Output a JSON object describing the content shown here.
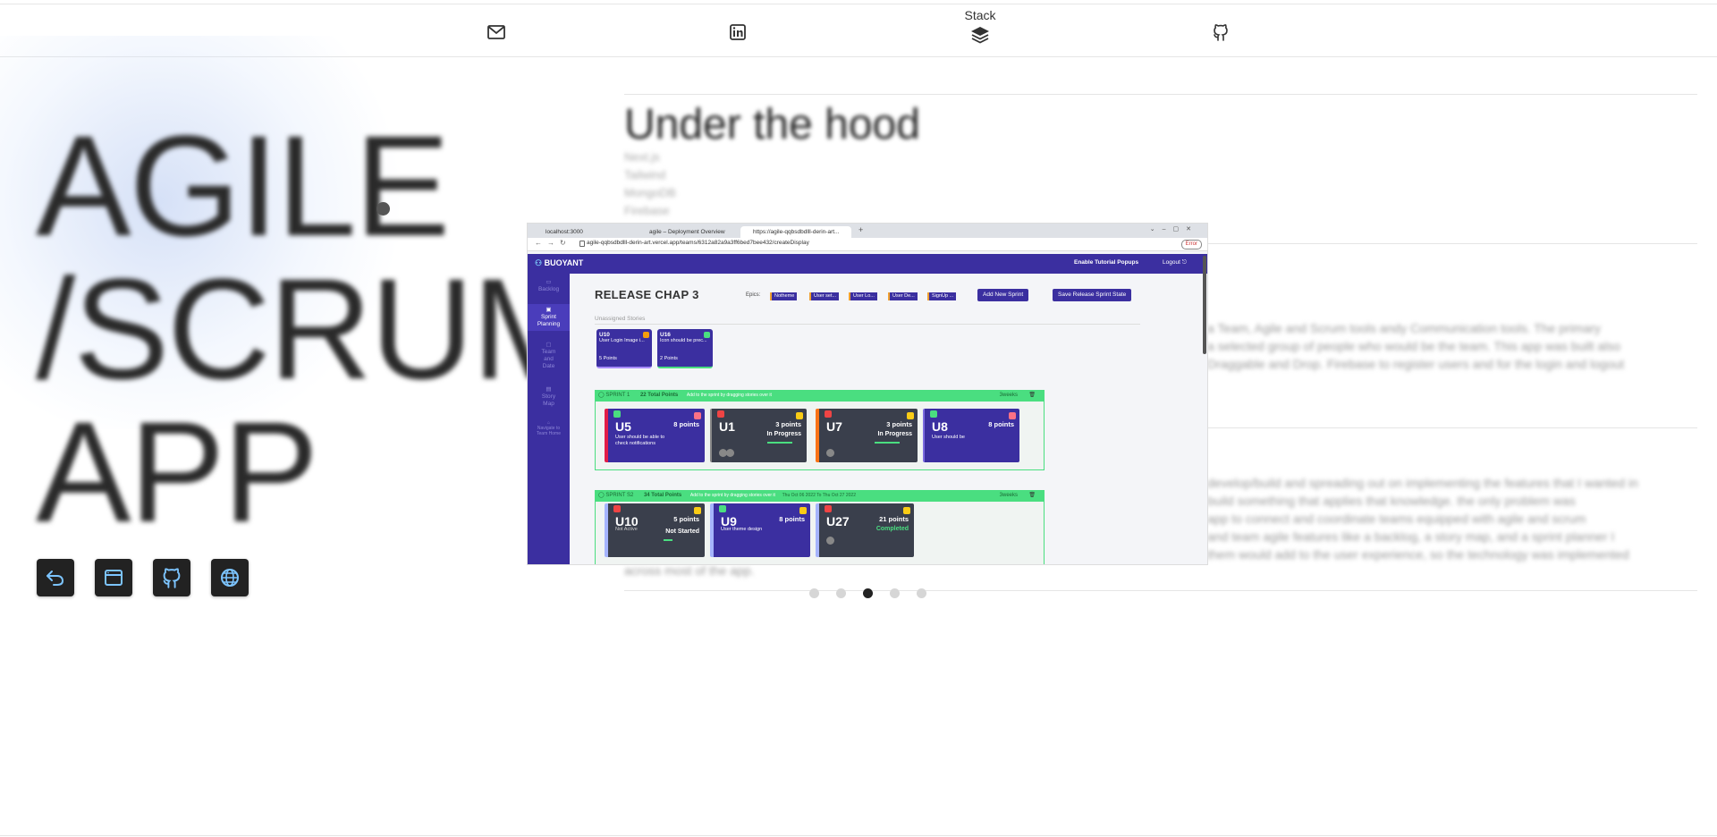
{
  "nav": {
    "stack_label": "Stack",
    "items": [
      "mail-icon",
      "linkedin-icon",
      "layers-icon",
      "github-icon"
    ]
  },
  "hero": {
    "title": "AGILE\n/SCRUM\nAPP",
    "buttons": [
      "back-icon",
      "window-icon",
      "github-icon",
      "globe-icon"
    ]
  },
  "right": {
    "heading": "Under the hood",
    "stack_list": [
      "Next.js",
      "Tailwind",
      "MongoDB",
      "Firebase"
    ],
    "para1": [
      "a Team, Agile and Scrum tools andy Communication tools. The primary",
      "a selected group of people who would be the team. This app was built also",
      "Draggable and Drop. Firebase to register users and for the login and logout"
    ],
    "para2": [
      "develop/build and spreading out on implementing the features that I wanted in",
      "build something that applies that knowledge. the only problem was",
      "app to connect and coordinate teams equipped with agile and scrum",
      "and team agile features like a backlog, a story map, and a sprint planner I",
      "them would add to the user experience, so the technology was implemented",
      "across most of the app."
    ]
  },
  "screenshot": {
    "tabs": [
      "localhost:3000",
      "agile – Deployment Overview",
      "https://agile-qqbsdbdlll-derin-art..."
    ],
    "url": "agile-qqbsdbdlll-derin-art.vercel.app/teams/6312a82a9a3ff6bed7bee432/createDisplay",
    "error_label": "Error",
    "brand": "BUOYANT",
    "tutorial": "Enable Tutorial Popups",
    "logout": "Logout",
    "sidebar": [
      "Backlog",
      "Sprint Planning",
      "Team and Date",
      "Story Map",
      "Navigate to Team Home"
    ],
    "release_title": "RELEASE CHAP 3",
    "epics_label": "Epics:",
    "epics": [
      "Notheme",
      "User set...",
      "User Lo...",
      "User De...",
      "SignUp ..."
    ],
    "add_sprint": "Add New Sprint",
    "save_state": "Save Release Sprint State",
    "unassigned_label": "Unassigned Stories",
    "unassigned": [
      {
        "id": "U10",
        "text": "User Login Image i...",
        "points": "5 Points"
      },
      {
        "id": "U16",
        "text": "Icon should be prec...",
        "points": "2 Points"
      }
    ],
    "sprint1": {
      "name": "SPRINT 1",
      "total": "22 Total Points",
      "hint": "Add to the sprint by dragging stories over it",
      "weeks": "3weeks",
      "cards": [
        {
          "id": "U5",
          "points": "8 points",
          "sub": "User should be able to check notifications",
          "status": ""
        },
        {
          "id": "U1",
          "points": "3 points",
          "sub": "",
          "status": "In Progress"
        },
        {
          "id": "U7",
          "points": "3 points",
          "sub": "",
          "status": "In Progress"
        },
        {
          "id": "U8",
          "points": "8 points",
          "sub": "User should be",
          "status": ""
        }
      ]
    },
    "sprint2": {
      "name": "SPRINT S2",
      "total": "34 Total Points",
      "hint": "Add to the sprint by dragging stories over it",
      "dates": "Thu Oct 06 2022  To  Thu Oct 27 2022",
      "weeks": "3weeks",
      "cards": [
        {
          "id": "U10",
          "points": "5 points",
          "sub": "Not Active",
          "status": "Not Started"
        },
        {
          "id": "U9",
          "points": "8 points",
          "sub": "User theme design",
          "status": ""
        },
        {
          "id": "U27",
          "points": "21 points",
          "sub": "",
          "status": "Completed"
        }
      ]
    }
  },
  "carousel": {
    "count": 5,
    "active_index": 2
  },
  "colors": {
    "app_purple": "#3b2fa0",
    "sprint_green": "#4ade80",
    "card_dark": "#3a3f4c"
  }
}
